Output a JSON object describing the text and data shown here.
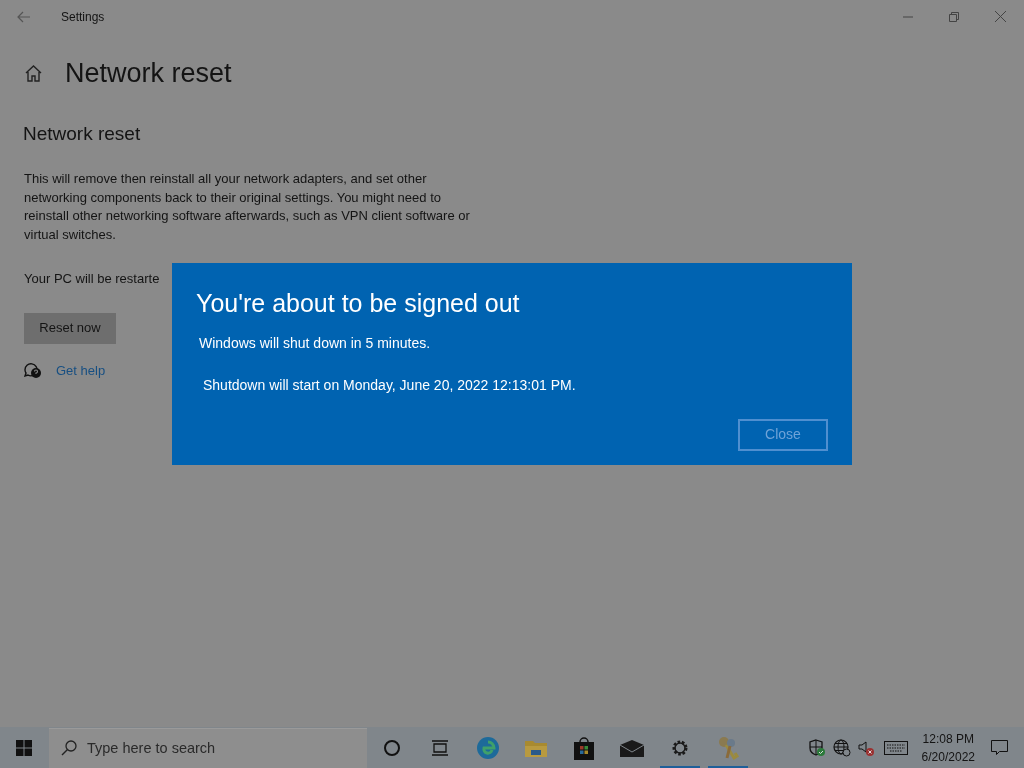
{
  "window": {
    "title": "Settings"
  },
  "page": {
    "title": "Network reset",
    "section_title": "Network reset",
    "description": "This will remove then reinstall all your network adapters, and set other networking components back to their original settings. You might need to reinstall other networking software afterwards, such as VPN client software or virtual switches.",
    "restart_note": "Your PC will be restarte",
    "reset_button": "Reset now",
    "help_link": "Get help"
  },
  "dialog": {
    "title": "You're about to be signed out",
    "message": "Windows will shut down in 5 minutes.",
    "detail": "Shutdown will start on Monday, June 20, 2022 12:13:01 PM.",
    "close_button": "Close"
  },
  "taskbar": {
    "search": {
      "placeholder": "Type here to search"
    },
    "apps": [
      {
        "kind": "cortana",
        "running": false
      },
      {
        "kind": "taskview",
        "running": false
      },
      {
        "kind": "edge",
        "running": false
      },
      {
        "kind": "explorer",
        "running": false
      },
      {
        "kind": "store",
        "running": false
      },
      {
        "kind": "mail",
        "running": false
      },
      {
        "kind": "settings",
        "running": true
      },
      {
        "kind": "keys",
        "running": true
      }
    ],
    "clock": {
      "time": "12:08 PM",
      "date": "6/20/2022"
    }
  }
}
